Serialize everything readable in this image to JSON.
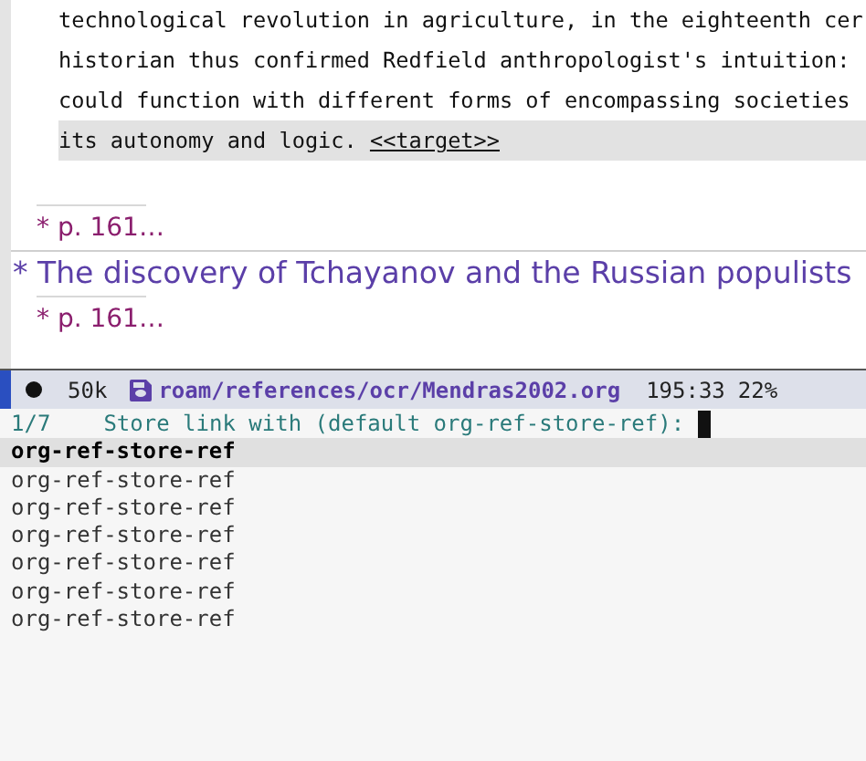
{
  "body_lines": [
    {
      "text": "technological revolution in agriculture, in the eighteenth cer",
      "highlighted": false
    },
    {
      "text": "historian thus confirmed Redfield anthropologist's intuition:",
      "highlighted": false
    },
    {
      "text": "could function with different forms of encompassing societies",
      "highlighted": false
    },
    {
      "text": "its autonomy and logic.",
      "link": "<<target>>",
      "highlighted": true
    }
  ],
  "outline": [
    {
      "kind": "subheading",
      "text": "* p. 161…"
    },
    {
      "kind": "heading",
      "text": "* The discovery of Tchayanov and the Russian populists"
    },
    {
      "kind": "subheading",
      "text": "* p. 161…"
    }
  ],
  "mode_line": {
    "size": "50k",
    "modified": false,
    "file": "roam/references/ocr/Mendras2002.org",
    "position": "195:33",
    "percent": "22%"
  },
  "minibuffer": {
    "count": "1/7",
    "prompt": "Store link with (default org-ref-store-ref):"
  },
  "candidates": [
    {
      "text": "org-ref-store-ref",
      "selected": true
    },
    {
      "text": "org-ref-store-ref",
      "selected": false
    },
    {
      "text": "org-ref-store-ref",
      "selected": false
    },
    {
      "text": "org-ref-store-ref",
      "selected": false
    },
    {
      "text": "org-ref-store-ref",
      "selected": false
    },
    {
      "text": "org-ref-store-ref",
      "selected": false
    },
    {
      "text": "org-ref-store-ref",
      "selected": false
    }
  ]
}
